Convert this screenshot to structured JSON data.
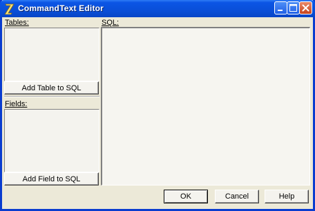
{
  "window": {
    "title": "CommandText Editor",
    "icon": "delphi-app-icon",
    "controls": {
      "minimize": "minimize-icon",
      "maximize": "maximize-icon",
      "close": "close-icon"
    }
  },
  "tables": {
    "label": "Tables:",
    "add_button_label": "Add Table to SQL"
  },
  "fields": {
    "label": "Fields:",
    "add_button_label": "Add Field to SQL"
  },
  "sql": {
    "label": "SQL:",
    "value": ""
  },
  "footer": {
    "ok_label": "OK",
    "cancel_label": "Cancel",
    "help_label": "Help"
  },
  "colors": {
    "titlebar": "#0a4fd8",
    "dialog_face": "#ece9d8",
    "close_button": "#c7441d"
  }
}
